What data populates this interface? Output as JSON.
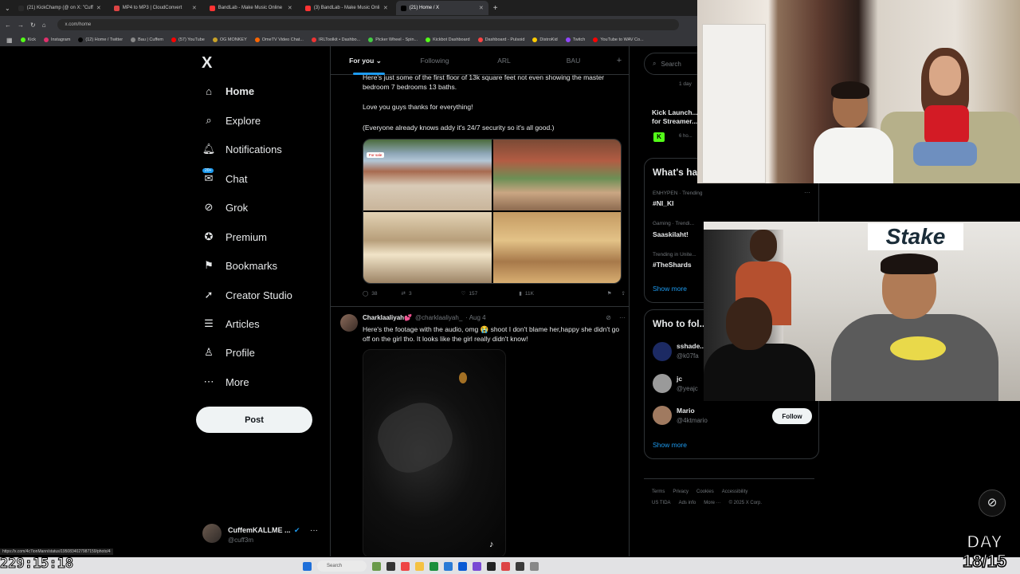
{
  "browser": {
    "tabs": [
      {
        "title": "(21) KickChamp (@ on X: \"Cuff",
        "color": "#2a2a2a",
        "active": false
      },
      {
        "title": "MP4 to MP3 | CloudConvert",
        "color": "#d44",
        "active": false
      },
      {
        "title": "BandLab - Make Music Online",
        "color": "#f33",
        "active": false
      },
      {
        "title": "(3) BandLab - Make Music Onli",
        "color": "#f33",
        "active": false
      },
      {
        "title": "(21) Home / X",
        "color": "#000",
        "active": true
      }
    ],
    "url": "x.com/home",
    "bookmarks": [
      {
        "label": "Kick",
        "color": "#53fc18"
      },
      {
        "label": "Instagram",
        "color": "#e1306c"
      },
      {
        "label": "(12) Home / Twitter",
        "color": "#000"
      },
      {
        "label": "Bau | Cuffem",
        "color": "#888"
      },
      {
        "label": "(57) YouTube",
        "color": "#f00"
      },
      {
        "label": "OG MONKEY",
        "color": "#c9a227"
      },
      {
        "label": "OmeTV Video Chat...",
        "color": "#f60"
      },
      {
        "label": "IRLToolkit • Dashbo...",
        "color": "#e33"
      },
      {
        "label": "Picker Wheel - Spin...",
        "color": "#4c4"
      },
      {
        "label": "Kickbot Dashboard",
        "color": "#53fc18"
      },
      {
        "label": "Dashboard - Pulsoid",
        "color": "#f44"
      },
      {
        "label": "DistroKid",
        "color": "#fc0"
      },
      {
        "label": "Twitch",
        "color": "#9146ff"
      },
      {
        "label": "YouTube to WAV Co...",
        "color": "#f00"
      }
    ]
  },
  "sidebar": {
    "logo": "X",
    "items": [
      {
        "label": "Home",
        "icon": "⌂",
        "active": true
      },
      {
        "label": "Explore",
        "icon": "⌕"
      },
      {
        "label": "Notifications",
        "icon": "🔔︎"
      },
      {
        "label": "Chat",
        "icon": "✉",
        "badge": "20+"
      },
      {
        "label": "Grok",
        "icon": "⊘"
      },
      {
        "label": "Premium",
        "icon": "✪"
      },
      {
        "label": "Bookmarks",
        "icon": "⚑"
      },
      {
        "label": "Creator Studio",
        "icon": "➚"
      },
      {
        "label": "Articles",
        "icon": "☰"
      },
      {
        "label": "Profile",
        "icon": "♙"
      },
      {
        "label": "More",
        "icon": "⋯"
      }
    ],
    "post_label": "Post",
    "account": {
      "name": "CuffemKALLME ...",
      "handle": "@cuff3m"
    }
  },
  "feed": {
    "tabs": [
      "For you",
      "Following",
      "ARL",
      "BAU",
      "+"
    ],
    "post1": {
      "lines": [
        "Here's just some of the first floor of 13k square feet not even showing the master bedroom 7 bedrooms 13 baths.",
        "Love you guys thanks for everything!",
        "(Everyone already knows addy it's 24/7 security so it's all good.)"
      ],
      "for_sale_tag": "For sale",
      "replies": "38",
      "reposts": "3",
      "likes": "157",
      "views": "11K"
    },
    "post2": {
      "name": "Charklaaliyah💕",
      "handle": "@charklaaliyah_",
      "date": "· Aug 4",
      "text": "Here's the footage with the audio, omg 😭 shoot I don't blame her,happy she didn't go off on the girl tho. It looks like the girl really didn't know!"
    }
  },
  "right": {
    "search_placeholder": "Search",
    "live_card": {
      "time": "1 day",
      "title": "Kick Launch... for Streamer...",
      "badge": "K",
      "sub": "6 ho..."
    },
    "trends_title": "What's ha...",
    "trends": [
      {
        "context": "ENHYPEN · Trending",
        "name": "#NI_KI"
      },
      {
        "context": "Gaming · Trendi...",
        "name": "Saaskilaht!"
      },
      {
        "context": "Trending in Unite...",
        "name": "#TheShards"
      }
    ],
    "show_more": "Show more",
    "who_to_follow_title": "Who to fol...",
    "suggestions": [
      {
        "name": "sshade...",
        "handle": "@k07fa",
        "color": "#1c2a63"
      },
      {
        "name": "jc",
        "handle": "@yeajc",
        "color": "#9a9a9a"
      },
      {
        "name": "Mario",
        "handle": "@4ktmario",
        "color": "#a07a60"
      }
    ],
    "follow_label": "Follow",
    "footer_line1": [
      "Terms",
      "Privacy",
      "Cookies",
      "Accessibility"
    ],
    "footer_line2": [
      "US TIDA",
      "Ads info",
      "More ···",
      "© 2025 X Corp."
    ]
  },
  "overlay": {
    "timer": "229:15:18",
    "status_url": "https://x.com/4c7ionMann/status/1950834027987159/photo/4",
    "day_label": "DAY",
    "day_count": "18/15",
    "stake_text": "Stake",
    "taskbar_search": "Search"
  }
}
